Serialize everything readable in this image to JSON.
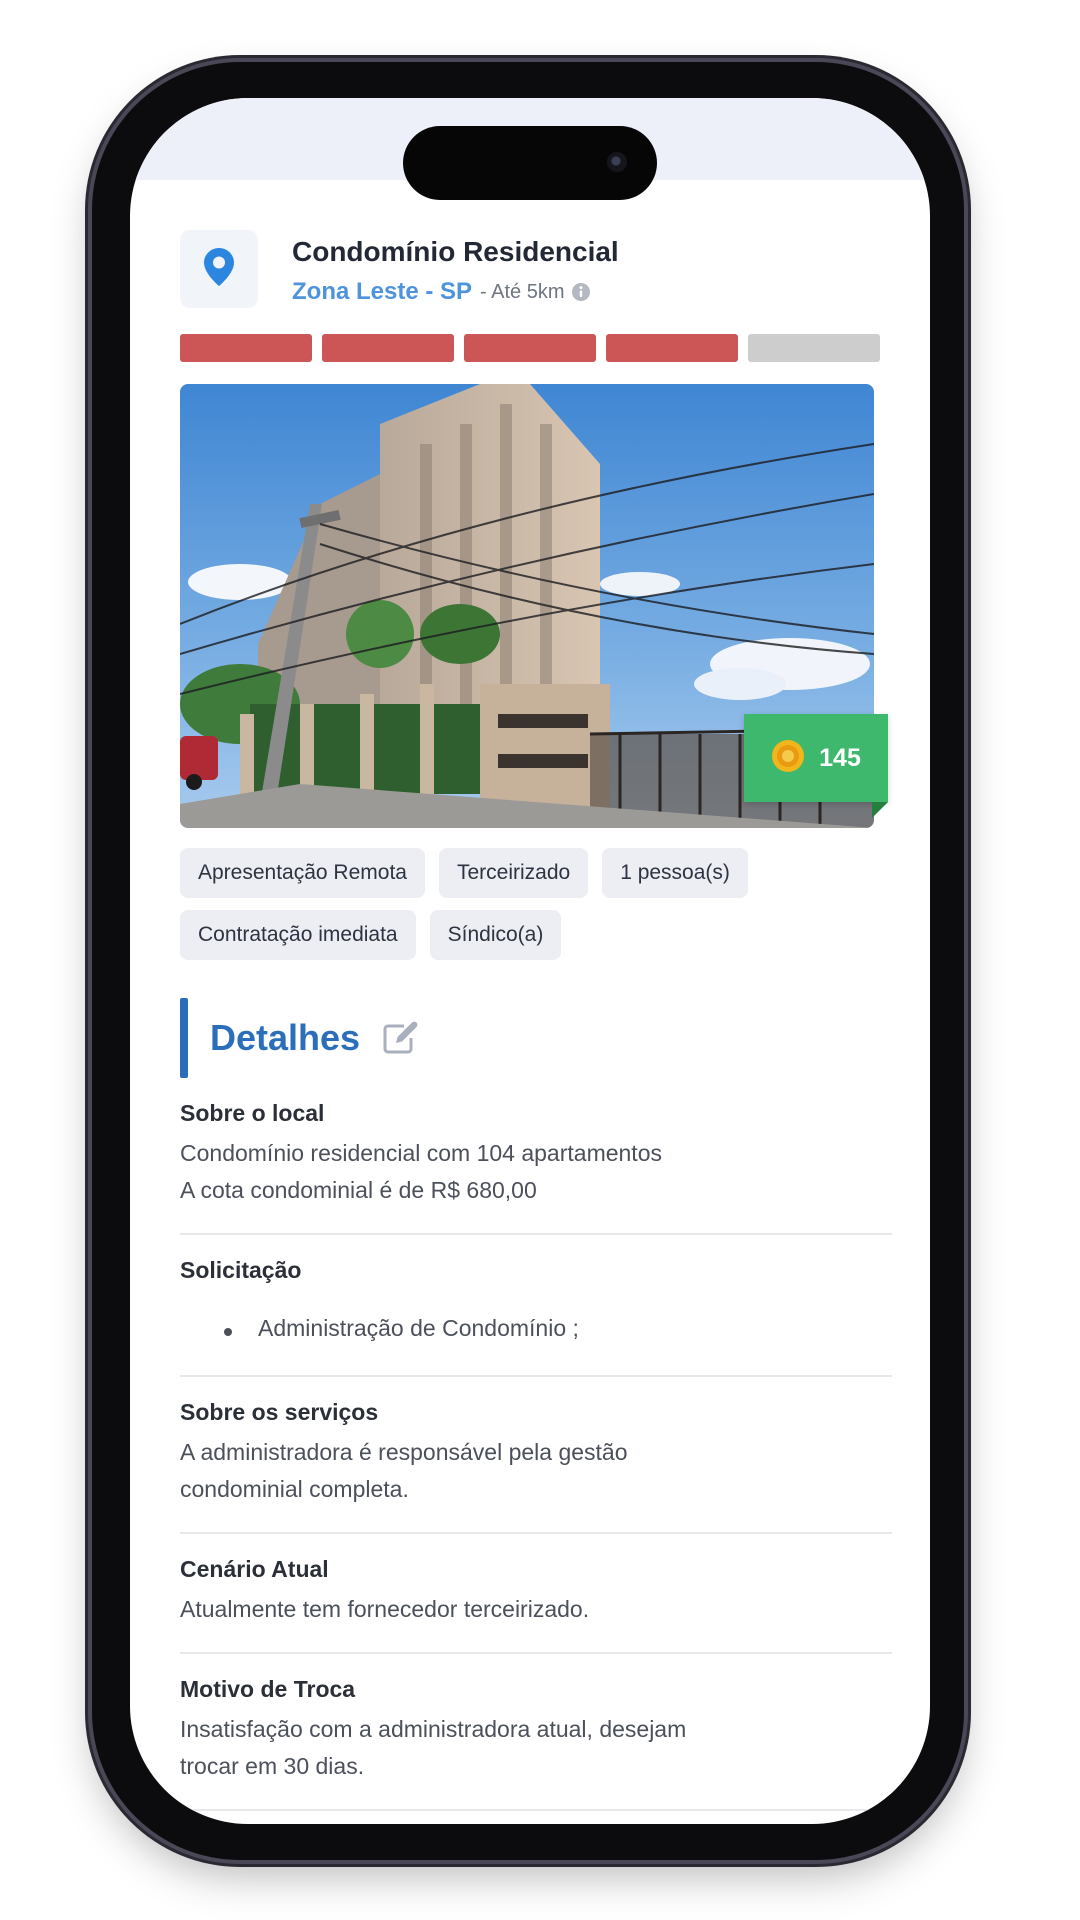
{
  "header": {
    "title": "Condomínio Residencial",
    "location": "Zona Leste - SP",
    "distance": "- Até 5km",
    "location_icon": "map-pin-icon",
    "info_icon": "info-icon"
  },
  "rating": {
    "filled": 4,
    "total": 5,
    "filled_color": "#cc5656",
    "empty_color": "#cdcdcd"
  },
  "photo": {
    "description_icon": "building-photo"
  },
  "badge": {
    "icon": "coin-icon",
    "value": "145",
    "color": "#3db86d"
  },
  "tags": [
    "Apresentação Remota",
    "Terceirizado",
    "1 pessoa(s)",
    "Contratação imediata",
    "Síndico(a)"
  ],
  "details": {
    "title": "Detalhes",
    "edit_icon": "edit-icon",
    "sections": {
      "about_place": {
        "title": "Sobre o local",
        "lines": [
          "Condomínio residencial com 104 apartamentos",
          "A cota condominial é de R$ 680,00"
        ]
      },
      "request": {
        "title": "Solicitação",
        "items": [
          "Administração de Condomínio ;"
        ]
      },
      "services": {
        "title": "Sobre os serviços",
        "lines": [
          "A administradora é responsável pela gestão",
          "condominial completa."
        ]
      },
      "scenario": {
        "title": "Cenário Atual",
        "lines": [
          "Atualmente tem fornecedor terceirizado."
        ]
      },
      "reason": {
        "title": "Motivo de Troca",
        "lines": [
          "Insatisfação com a administradora atual, desejam",
          "trocar em 30 dias."
        ]
      }
    }
  }
}
